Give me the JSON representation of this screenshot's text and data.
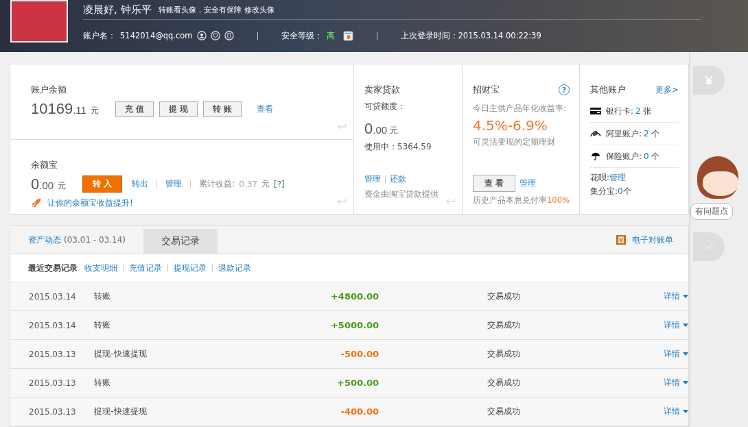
{
  "header": {
    "greeting": "凌晨好, 钟乐平",
    "avatar_note": "转账看头像，安全有保障",
    "avatar_link": "修改头像",
    "account_label": "账户名：",
    "account": "5142014@qq.com",
    "security_label": "安全等级：",
    "security_level": "高",
    "last_login": "上次登录时间：2015.03.14 00:22:39"
  },
  "balance": {
    "title": "账户余额",
    "amount_int": "10169",
    "amount_dec": ".11",
    "unit": "元",
    "buttons": [
      "充 值",
      "提 现",
      "转 账"
    ],
    "link": "查看"
  },
  "yuebao": {
    "title": "余额宝",
    "amount_int": "0",
    "amount_dec": ".00",
    "unit": "元",
    "primary_button": "转 入",
    "links": [
      "转出",
      "管理"
    ],
    "earnings_label": "累计收益:",
    "earnings": "0.37",
    "earnings_unit": "元",
    "help": "[?]",
    "promo": "让你的余额宝收益提升!"
  },
  "loan": {
    "title": "卖家贷款",
    "quota_label": "可贷额度：",
    "amount_int": "0",
    "amount_dec": ".00",
    "unit": "元",
    "in_use_label": "使用中：",
    "in_use": "5364.59",
    "links": [
      "管理",
      "还款"
    ],
    "note": "资金由淘宝贷款提供"
  },
  "zhaocai": {
    "title": "招财宝",
    "help": "?",
    "rate_label": "今日主供产品年化收益率:",
    "rate": "4.5%-6.9%",
    "desc": "可灵活变现的定期理财",
    "button": "查 看",
    "link": "管理",
    "history_label": "历史产品本息兑付率",
    "history_value": "100%"
  },
  "other": {
    "title": "其他账户",
    "more": "更多>",
    "items": [
      {
        "kind": "card",
        "label": "银行卡:",
        "value": "2",
        "unit": "张"
      },
      {
        "kind": "ali",
        "label": "阿里账户:",
        "value": "2",
        "unit": "个"
      },
      {
        "kind": "umbrella",
        "label": "保险账户:",
        "value": "0",
        "unit": "个"
      }
    ],
    "huabei_label": "花呗:",
    "huabei_link": "管理",
    "jifen_label": "集分宝:",
    "jifen_value": "0",
    "jifen_unit": "个"
  },
  "tabs": [
    {
      "label": "资产动态",
      "extra": "(03.01 - 03.14)",
      "selected": false
    },
    {
      "label": "交易记录",
      "selected": true
    }
  ],
  "statement": "电子对账单",
  "subnav": {
    "title": "最近交易记录",
    "links": [
      "收支明细",
      "充值记录",
      "提现记录",
      "退款记录"
    ]
  },
  "transactions": [
    {
      "date": "2015.03.14",
      "type": "转账",
      "amount": "+4800.00",
      "kind": "income",
      "status": "交易成功",
      "detail": "详情"
    },
    {
      "date": "2015.03.14",
      "type": "转账",
      "amount": "+5000.00",
      "kind": "income",
      "status": "交易成功",
      "detail": "详情"
    },
    {
      "date": "2015.03.13",
      "type": "提现-快速提现",
      "amount": "-500.00",
      "kind": "expense",
      "status": "交易成功",
      "detail": "详情"
    },
    {
      "date": "2015.03.13",
      "type": "转账",
      "amount": "+500.00",
      "kind": "income",
      "status": "交易成功",
      "detail": "详情"
    },
    {
      "date": "2015.03.13",
      "type": "提现-快速提现",
      "amount": "-400.00",
      "kind": "expense",
      "status": "交易成功",
      "detail": "详情"
    }
  ],
  "side": {
    "tip": "有问题点"
  }
}
